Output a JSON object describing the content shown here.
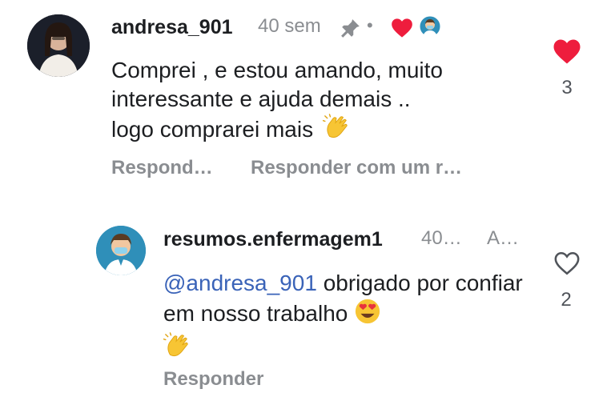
{
  "comment": {
    "username": "andresa_901",
    "time": "40 sem",
    "separator": "•",
    "text": "Comprei , e estou amando, muito interessante e ajuda demais ..",
    "text_line3": "logo comprarei mais",
    "emoji_end": "👏",
    "likes": "3",
    "liked": true,
    "actions": {
      "reply": "Respond…",
      "reply_gif": "Responder com um r…"
    },
    "colors": {
      "heart": "#ee1d3d",
      "muted": "#8a8d91"
    }
  },
  "reply": {
    "username": "resumos.enfermagem1",
    "time": "40…",
    "badge": "A…",
    "mention": "@andresa_901",
    "text": "obrigado por confiar em nosso trabalho",
    "emoji_heart_eyes": "😍",
    "emoji_clap": "👏",
    "likes": "2",
    "liked": false,
    "actions": {
      "reply": "Responder"
    }
  }
}
